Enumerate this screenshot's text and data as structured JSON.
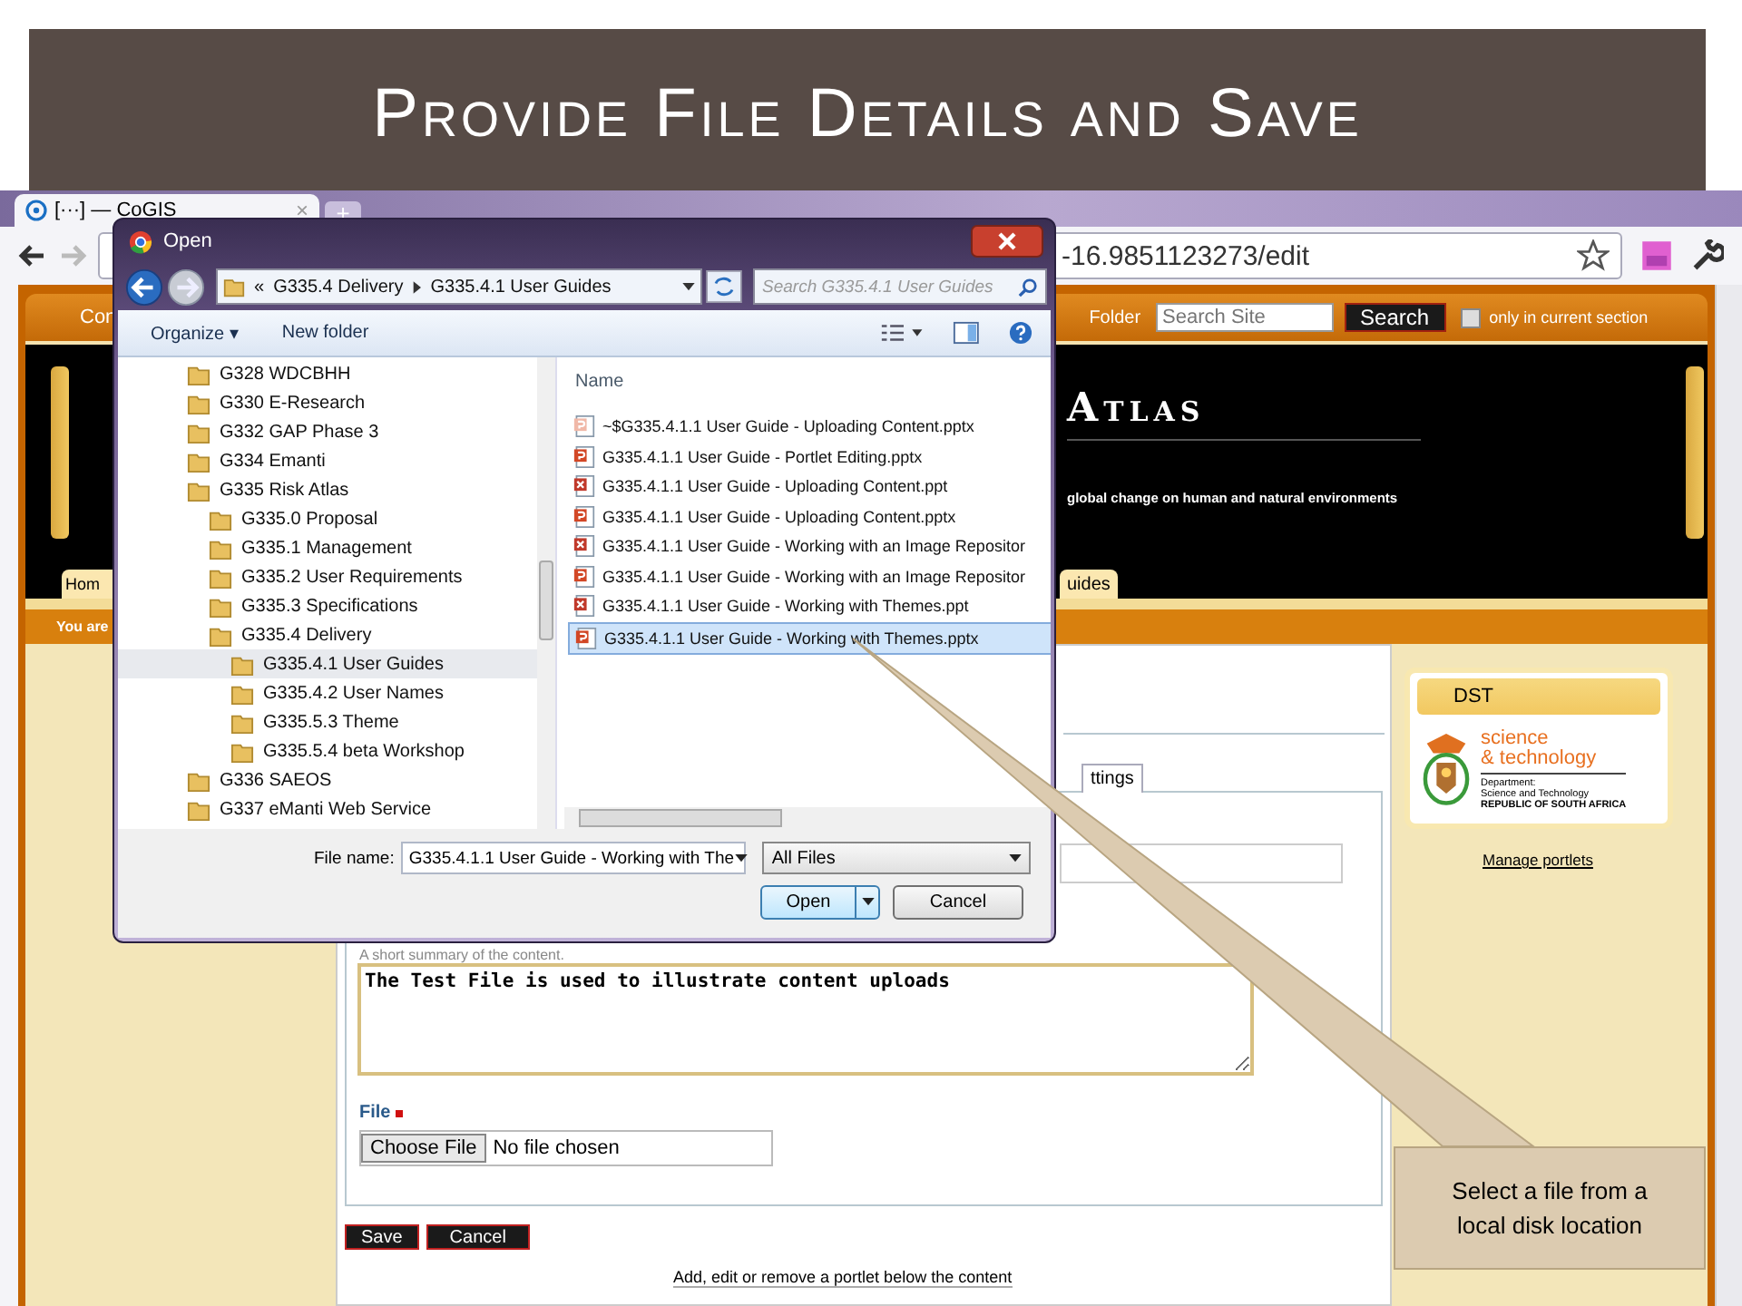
{
  "slide": {
    "title": "Provide File Details and Save"
  },
  "browser": {
    "tab_title": "[···] — CoGIS",
    "tab_close": "×",
    "new_tab": "+",
    "address": "-16.9851123273/edit"
  },
  "site": {
    "nav_fragment": "Con",
    "nav_folder": "Folder",
    "search": {
      "placeholder": "Search Site",
      "button": "Search"
    },
    "section_only": {
      "label": "only in current section",
      "checked": false
    },
    "banner_title": "Atlas",
    "tagline": "global change on human and natural environments",
    "tabs": [
      "Hom",
      "uides"
    ],
    "breadcrumb": "You are"
  },
  "form": {
    "tab_fragment": "ttings",
    "summary_hint": "A short summary of the content.",
    "description": "The Test File is used to illustrate content uploads",
    "file_label": "File",
    "file_required": true,
    "choose_button": "Choose File",
    "file_status": "No file chosen",
    "buttons": [
      "Save",
      "Cancel"
    ],
    "portlet_link": "Add, edit or remove a portlet below the content"
  },
  "portlet": {
    "title": "DST",
    "logo_line1": "science",
    "logo_line2": "& technology",
    "logo_dept": "Department:",
    "logo_dept_name": "Science and Technology",
    "logo_country": "REPUBLIC OF SOUTH AFRICA",
    "manage_link": "Manage portlets"
  },
  "dialog": {
    "title": "Open",
    "path_prefix": "«",
    "path": [
      "G335.4 Delivery",
      "G335.4.1 User Guides"
    ],
    "search_placeholder": "Search G335.4.1 User Guides",
    "toolbar": [
      "Organize ▾",
      "New folder"
    ],
    "tree": [
      {
        "label": "G328 WDCBHH",
        "selected": false
      },
      {
        "label": "G330 E-Research",
        "selected": false
      },
      {
        "label": "G332 GAP Phase 3",
        "selected": false
      },
      {
        "label": "G334 Emanti",
        "selected": false
      },
      {
        "label": "G335 Risk Atlas",
        "selected": false,
        "children": [
          {
            "label": "G335.0 Proposal",
            "selected": false
          },
          {
            "label": "G335.1 Management",
            "selected": false
          },
          {
            "label": "G335.2 User Requirements",
            "selected": false
          },
          {
            "label": "G335.3 Specifications",
            "selected": false
          },
          {
            "label": "G335.4 Delivery",
            "selected": false,
            "children": [
              {
                "label": "G335.4.1 User Guides",
                "selected": true
              },
              {
                "label": "G335.4.2 User Names",
                "selected": false
              },
              {
                "label": "G335.5.3 Theme",
                "selected": false
              },
              {
                "label": "G335.5.4 beta Workshop",
                "selected": false
              }
            ]
          }
        ]
      },
      {
        "label": "G336 SAEOS",
        "selected": false
      },
      {
        "label": "G337 eManti Web Service",
        "selected": false
      }
    ],
    "column_header": "Name",
    "files": [
      {
        "name": "~$G335.4.1.1 User Guide - Uploading Content.pptx",
        "kind": "temp",
        "selected": false
      },
      {
        "name": "G335.4.1.1 User Guide - Portlet Editing.pptx",
        "kind": "pptx",
        "selected": false
      },
      {
        "name": "G335.4.1.1 User Guide - Uploading Content.ppt",
        "kind": "ppt",
        "selected": false
      },
      {
        "name": "G335.4.1.1 User Guide - Uploading Content.pptx",
        "kind": "pptx",
        "selected": false
      },
      {
        "name": "G335.4.1.1 User Guide - Working with an Image Repositor",
        "kind": "ppt",
        "selected": false
      },
      {
        "name": "G335.4.1.1 User Guide - Working with an Image Repositor",
        "kind": "pptx",
        "selected": false
      },
      {
        "name": "G335.4.1.1 User Guide - Working with Themes.ppt",
        "kind": "ppt",
        "selected": false
      },
      {
        "name": "G335.4.1.1 User Guide - Working with Themes.pptx",
        "kind": "pptx",
        "selected": true
      }
    ],
    "file_name_label": "File name:",
    "file_name": "G335.4.1.1 User Guide - Working with The",
    "filter": "All Files",
    "open_button": "Open",
    "cancel_button": "Cancel"
  },
  "callout": {
    "text": "Select a file from a local disk location"
  }
}
